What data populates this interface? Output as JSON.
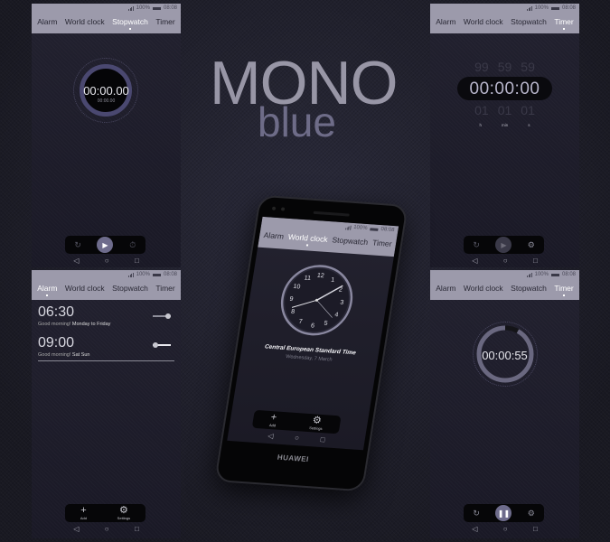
{
  "branding": {
    "title_line1": "MONO",
    "title_line2": "blue",
    "device_brand": "HUAWEI"
  },
  "status_bar": {
    "battery": "100%",
    "time": "08:08"
  },
  "tabs": [
    "Alarm",
    "World clock",
    "Stopwatch",
    "Timer"
  ],
  "nav_icons": [
    "back-icon",
    "home-icon",
    "recents-icon"
  ],
  "screens": {
    "stopwatch": {
      "active_tab": "Stopwatch",
      "time": "00:00.00",
      "lap_time": "00:00.00",
      "controls": [
        "reset-icon",
        "play-icon",
        "lap-icon"
      ]
    },
    "timer_setup": {
      "active_tab": "Timer",
      "above": [
        "99",
        "59",
        "59"
      ],
      "value": "00:00:00",
      "below": [
        "01",
        "01",
        "01"
      ],
      "units": [
        "h",
        "min",
        "s"
      ],
      "controls": [
        "reset-icon",
        "play-icon",
        "settings-icon"
      ]
    },
    "alarm": {
      "active_tab": "Alarm",
      "alarms": [
        {
          "time": "06:30",
          "label": "Good morning!",
          "repeat": "Monday to Friday",
          "enabled": true
        },
        {
          "time": "09:00",
          "label": "Good morning!",
          "repeat": "Sat Sun",
          "enabled": false
        }
      ],
      "bottom_actions": [
        {
          "icon": "add-icon",
          "label": "Add"
        },
        {
          "icon": "settings-icon",
          "label": "Settings"
        }
      ]
    },
    "timer_running": {
      "active_tab": "Timer",
      "time": "00:00:55",
      "progress": 0.92,
      "controls": [
        "reset-icon",
        "pause-icon",
        "settings-icon"
      ]
    },
    "world_clock": {
      "active_tab": "World clock",
      "clock_numbers": [
        "12",
        "1",
        "2",
        "3",
        "4",
        "5",
        "6",
        "7",
        "8",
        "9",
        "10",
        "11"
      ],
      "timezone": "Central European Standard Time",
      "date": "Wednesday, 7 March",
      "bottom_actions": [
        {
          "icon": "add-icon",
          "label": "Add"
        },
        {
          "icon": "settings-icon",
          "label": "Settings"
        }
      ]
    }
  },
  "colors": {
    "appbar": "#9c9aab",
    "accent": "#6e6c8c",
    "background": "#1e1e2a"
  }
}
